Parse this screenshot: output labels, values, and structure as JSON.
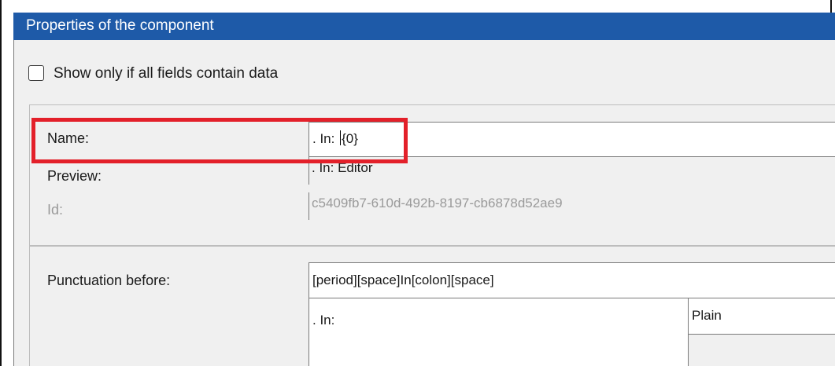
{
  "window": {
    "title": "Properties of the component"
  },
  "options": {
    "show_only_if_all_label": "Show only if all fields contain data",
    "show_only_if_all_checked": false
  },
  "fields": {
    "name_label": "Name:",
    "name_value_before_caret": ". In: ",
    "name_value_after_caret": "{0}",
    "preview_label": "Preview:",
    "preview_value": ". In: Editor",
    "id_label": "Id:",
    "id_value": "c5409fb7-610d-492b-8197-cb6878d52ae9"
  },
  "punctuation": {
    "before_label": "Punctuation before:",
    "before_value": "[period][space]In[colon][space]",
    "preview_text": ". In:",
    "style_value": "Plain"
  },
  "annotation": {
    "highlight_color": "#e3202a"
  },
  "colors": {
    "titlebar": "#1e5aa8"
  }
}
